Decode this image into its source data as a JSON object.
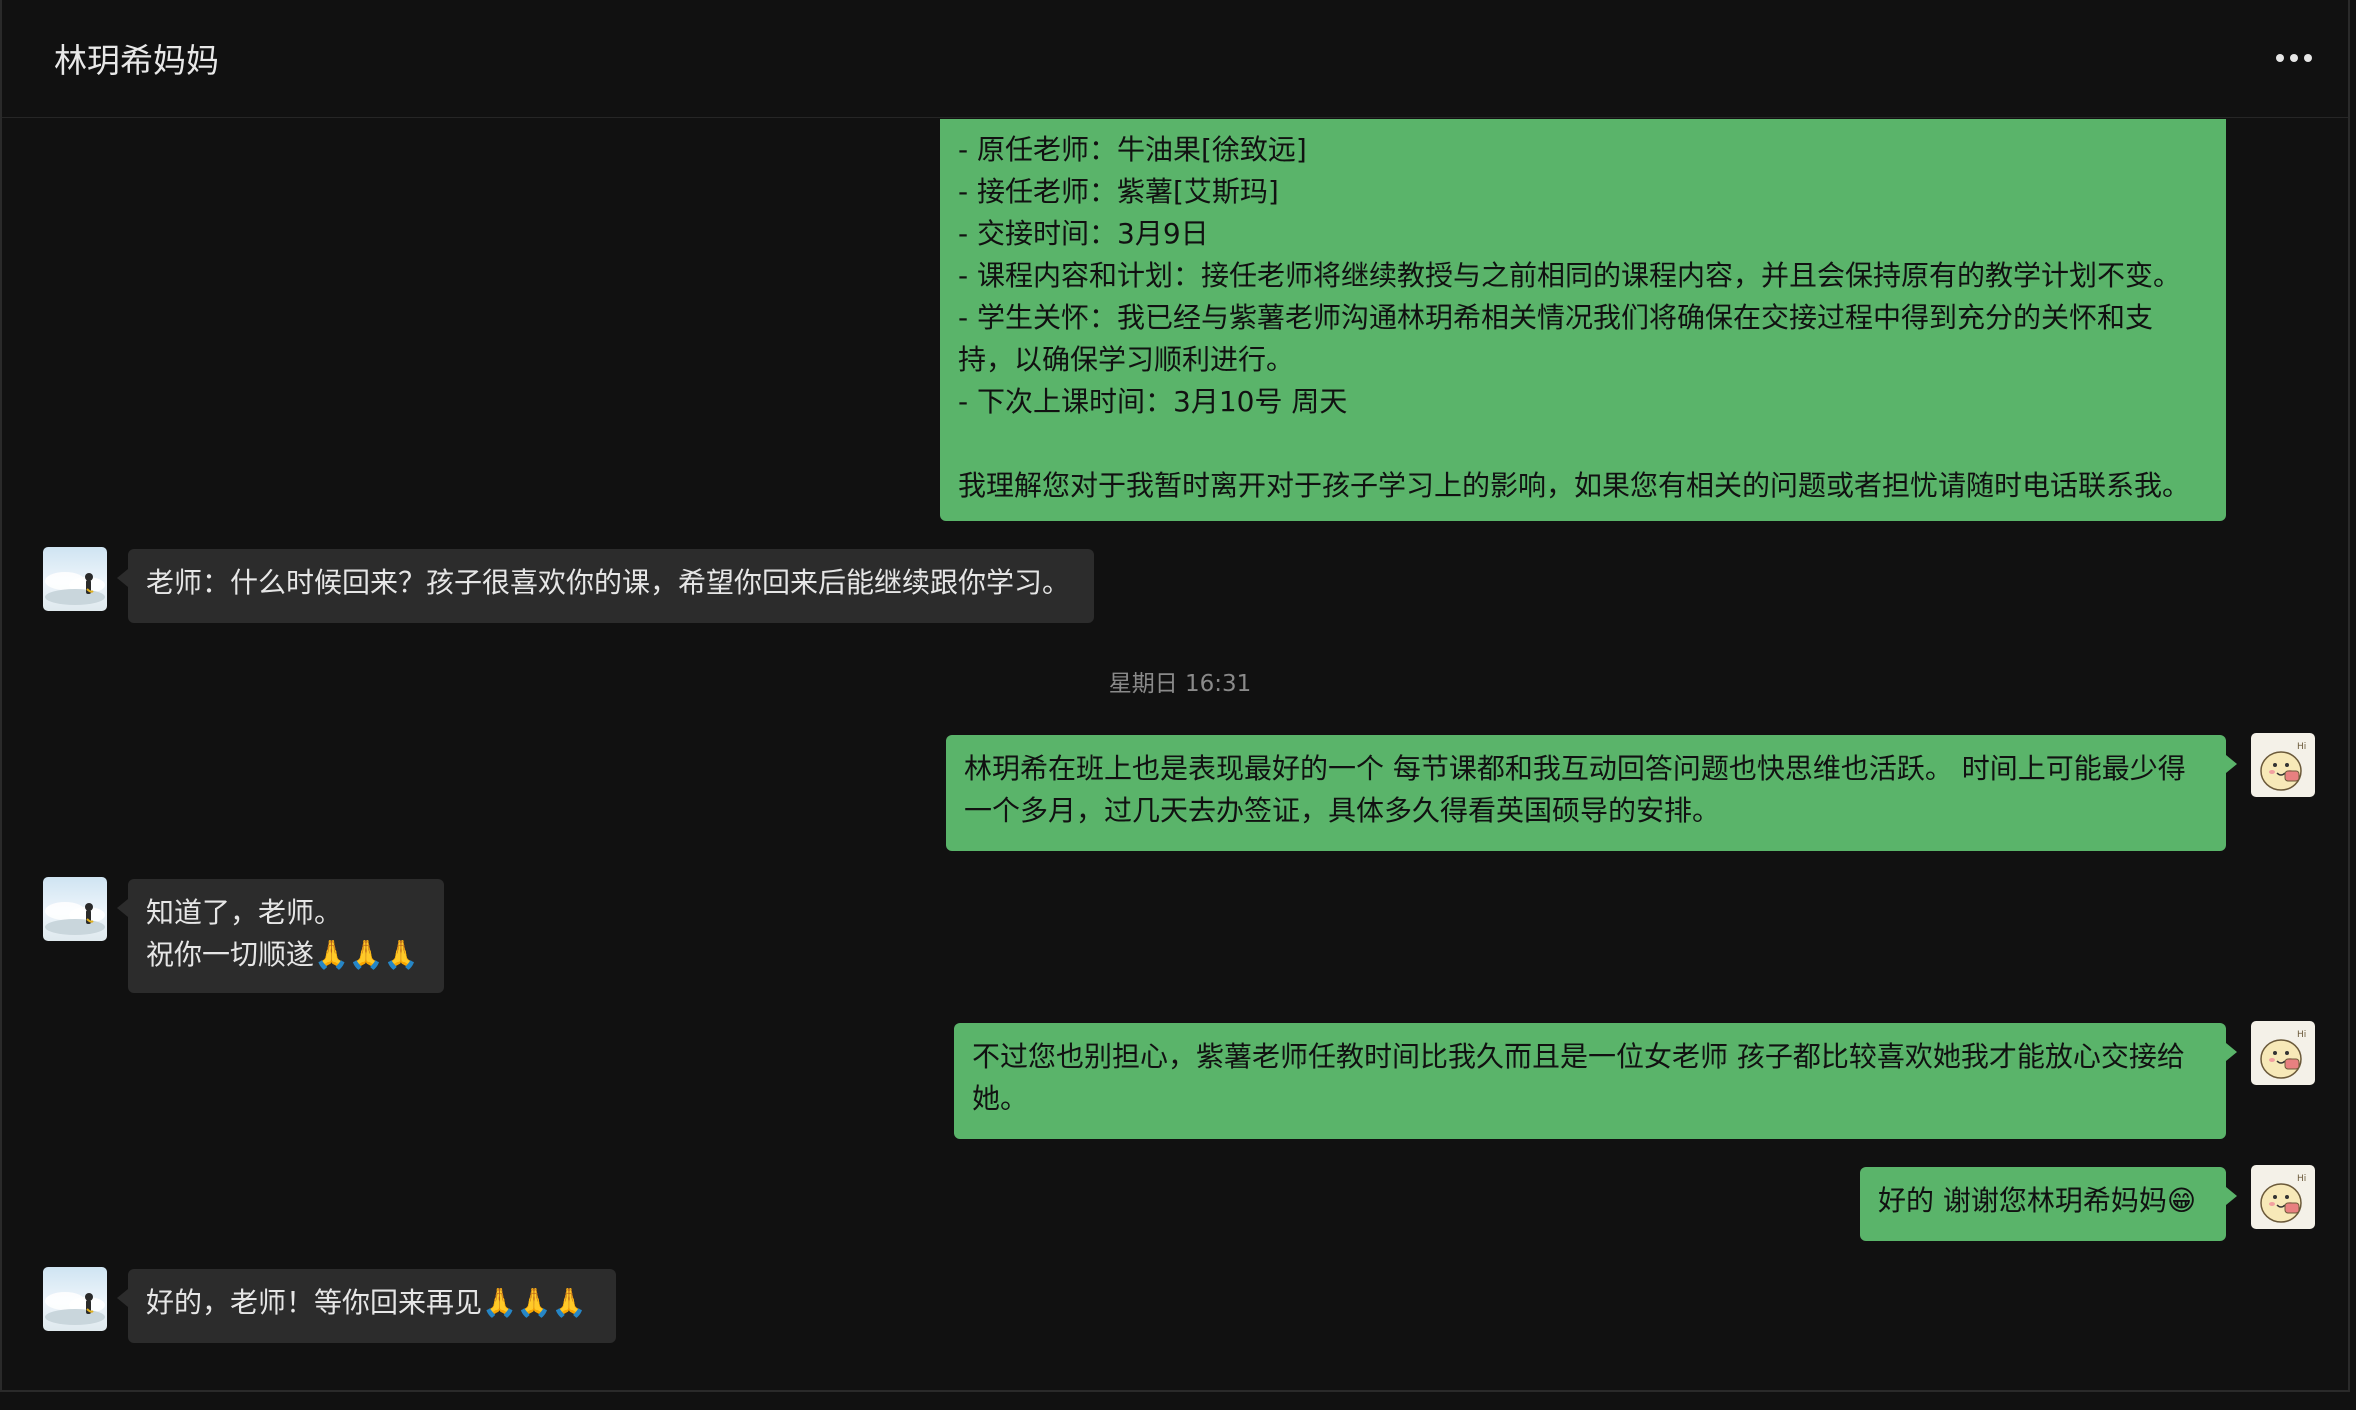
{
  "header": {
    "title": "林玥希妈妈",
    "more_icon": "more-horizontal-icon"
  },
  "messages": {
    "m1": {
      "sender": "me",
      "text": "- 原任老师：牛油果[徐致远]\n- 接任老师：紫薯[艾斯玛]\n- 交接时间：3月9日\n- 课程内容和计划：接任老师将继续教授与之前相同的课程内容，并且会保持原有的教学计划不变。\n- 学生关怀：我已经与紫薯老师沟通林玥希相关情况我们将确保在交接过程中得到充分的关怀和支持，以确保学习顺利进行。\n- 下次上课时间：3月10号 周天\n\n我理解您对于我暂时离开对于孩子学习上的影响，如果您有相关的问题或者担忧请随时电话联系我。"
    },
    "m2": {
      "sender": "them",
      "text": "老师：什么时候回来？孩子很喜欢你的课，希望你回来后能继续跟你学习。"
    },
    "timestamp": "星期日 16:31",
    "m3": {
      "sender": "me",
      "text": "林玥希在班上也是表现最好的一个 每节课都和我互动回答问题也快思维也活跃。 时间上可能最少得一个多月，过几天去办签证，具体多久得看英国硕导的安排。"
    },
    "m4": {
      "sender": "them",
      "text": "知道了，老师。\n祝你一切顺遂🙏🙏🙏"
    },
    "m5": {
      "sender": "me",
      "text": "不过您也别担心，紫薯老师任教时间比我久而且是一位女老师 孩子都比较喜欢她我才能放心交接给她。"
    },
    "m6": {
      "sender": "me",
      "text": "好的 谢谢您林玥希妈妈😁"
    },
    "m7": {
      "sender": "them",
      "text": "好的，老师！等你回来再见🙏🙏🙏"
    }
  },
  "colors": {
    "background": "#111111",
    "my_bubble": "#5ab46a",
    "their_bubble": "#2c2c2c",
    "timestamp": "#8a8a8a"
  }
}
